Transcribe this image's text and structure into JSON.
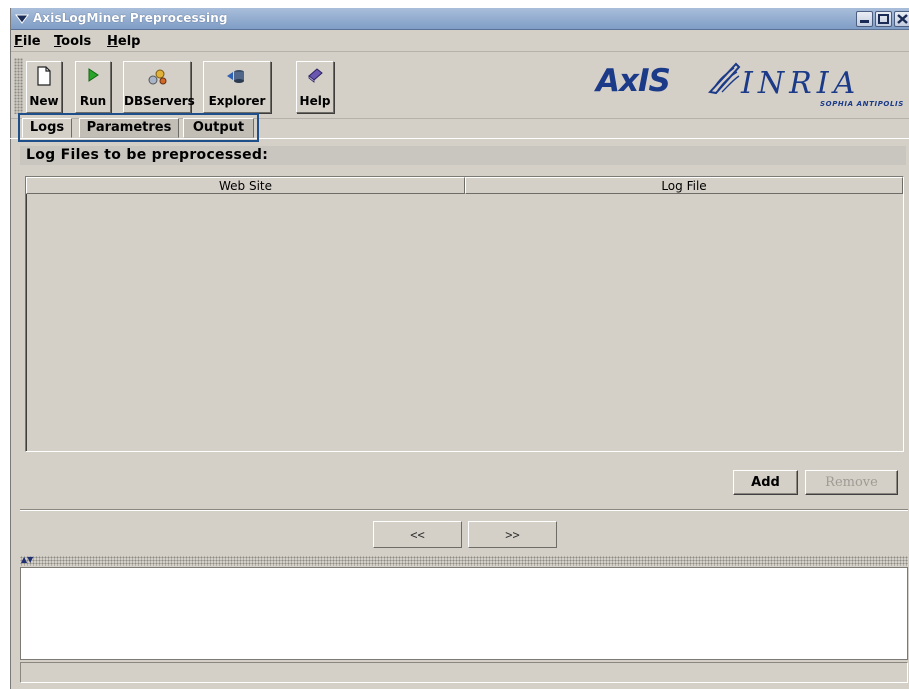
{
  "window": {
    "title": "AxisLogMiner Preprocessing"
  },
  "menu": [
    {
      "first": "F",
      "rest": "ile"
    },
    {
      "first": "T",
      "rest": "ools"
    },
    {
      "first": "H",
      "rest": "elp"
    }
  ],
  "toolbar": {
    "new_label": "New",
    "run_label": "Run",
    "dbservers_label": "DBServers",
    "explorer_label": "Explorer",
    "help_label": "Help"
  },
  "logos": {
    "axis": "AxIS",
    "inria": "INRIA",
    "sophia": "SOPHIA ANTIPOLIS"
  },
  "tabs": [
    {
      "label": "Logs",
      "selected": true
    },
    {
      "label": "Parametres",
      "selected": false
    },
    {
      "label": "Output",
      "selected": false
    }
  ],
  "logs_panel": {
    "title": "Log Files to be preprocessed:",
    "columns": [
      "Web Site",
      "Log File"
    ],
    "rows": [],
    "add_label": "Add",
    "remove_label": "Remove",
    "remove_enabled": false
  },
  "navigation": {
    "back_label": "<<",
    "forward_label": ">>"
  },
  "console": {
    "text": ""
  },
  "colors": {
    "title_bar": "#8fa9cf",
    "logo_blue": "#1b3a88",
    "tab_outline": "#1f4f8a",
    "panel_bg": "#d4d0c8"
  }
}
